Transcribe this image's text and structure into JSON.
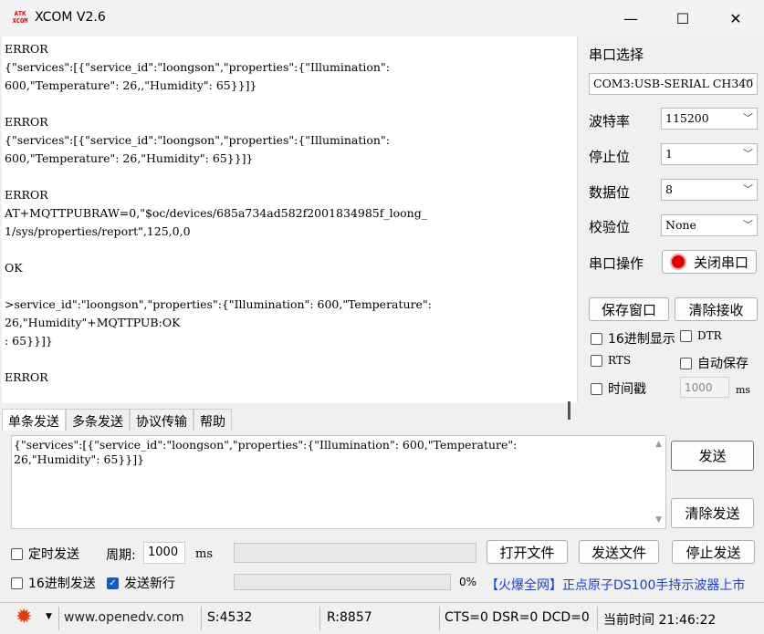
{
  "titlebar": {
    "logo_top": "ATK",
    "logo_bottom": "XCOM",
    "title": "XCOM V2.6",
    "minimize": "—",
    "maximize": "☐",
    "close": "✕"
  },
  "receive": {
    "text": "ERROR\n{\"services\":[{\"service_id\":\"loongson\",\"properties\":{\"Illumination\":\n600,\"Temperature\": 26,,\"Humidity\": 65}}]}\n\nERROR\n{\"services\":[{\"service_id\":\"loongson\",\"properties\":{\"Illumination\":\n600,\"Temperature\": 26,\"Humidity\": 65}}]}\n\nERROR\nAT+MQTTPUBRAW=0,\"$oc/devices/685a734ad582f2001834985f_loong_\n1/sys/properties/report\",125,0,0\n\nOK\n\n>service_id\":\"loongson\",\"properties\":{\"Illumination\": 600,\"Temperature\":\n26,\"Humidity\"+MQTTPUB:OK\n: 65}}]}\n\nERROR"
  },
  "settings": {
    "port_select_label": "串口选择",
    "port_value": "COM3:USB-SERIAL CH340",
    "baud_label": "波特率",
    "baud_value": "115200",
    "stopbits_label": "停止位",
    "stopbits_value": "1",
    "databits_label": "数据位",
    "databits_value": "8",
    "parity_label": "校验位",
    "parity_value": "None",
    "port_op_label": "串口操作",
    "close_port_button": "关闭串口",
    "save_window_button": "保存窗口",
    "clear_receive_button": "清除接收",
    "hex_display": "16进制显示",
    "dtr": "DTR",
    "rts": "RTS",
    "auto_save": "自动保存",
    "timestamp": "时间戳",
    "timestamp_value": "1000",
    "ms": "ms"
  },
  "tabs": [
    "单条发送",
    "多条发送",
    "协议传输",
    "帮助"
  ],
  "send": {
    "text": "{\"services\":[{\"service_id\":\"loongson\",\"properties\":{\"Illumination\": 600,\"Temperature\":\n26,\"Humidity\": 65}}]}",
    "send_button": "发送",
    "clear_send_button": "清除发送",
    "timed_send": "定时发送",
    "period_label": "周期:",
    "period_value": "1000",
    "period_unit": "ms",
    "open_file_button": "打开文件",
    "send_file_button": "发送文件",
    "stop_send_button": "停止发送",
    "hex_send": "16进制发送",
    "send_newline": "发送新行",
    "progress_text": "0%",
    "progress": 0,
    "ad_text": "【火爆全网】正点原子DS100手持示波器上市"
  },
  "statusbar": {
    "website": "www.openedv.com",
    "sent": "S:4532",
    "received": "R:8857",
    "signals": "CTS=0 DSR=0 DCD=0",
    "time": "当前时间 21:46:22"
  },
  "colors": {
    "accent": "#0a5fd0",
    "ad_link": "#1a3fd8",
    "close_port_red": "#e00000",
    "gear": "#e23a00"
  }
}
